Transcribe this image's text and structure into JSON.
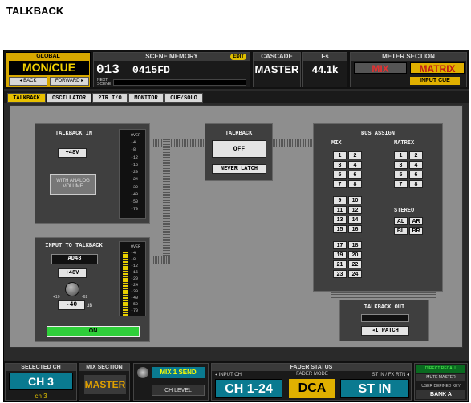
{
  "callout": {
    "label": "TALKBACK"
  },
  "global": {
    "label": "GLOBAL",
    "mode": "MON/CUE",
    "back": "◂ BACK",
    "forward": "FORWARD ▸"
  },
  "scene_memory": {
    "title": "SCENE MEMORY",
    "edit": "EDIT",
    "number": "013",
    "name": "0415FD",
    "next_label": "NEXT SCENE"
  },
  "cascade": {
    "title": "CASCADE",
    "value": "MASTER"
  },
  "fs": {
    "title": "Fs",
    "value": "44.1k"
  },
  "meter_section": {
    "title": "METER SECTION",
    "mix": "MIX",
    "matrix": "MATRIX",
    "input_cue": "INPUT CUE"
  },
  "tabs": [
    "TALKBACK",
    "OSCILLATOR",
    "2TR I/O",
    "MONITOR",
    "CUE/SOLO"
  ],
  "talkback_in": {
    "title": "TALKBACK IN",
    "phantom": "+48V",
    "with_analog_volume": "WITH ANALOG VOLUME"
  },
  "meter_scale": [
    "OVER",
    "-4",
    "-8",
    "-12",
    "-16",
    "-20",
    "-24",
    "-30",
    "-40",
    "-50",
    "-70"
  ],
  "talkback": {
    "title": "TALKBACK",
    "state": "OFF",
    "latch": "NEVER LATCH"
  },
  "input_to_talkback": {
    "title": "INPUT TO TALKBACK",
    "input": "AD48",
    "phantom": "+48V",
    "gain_max": "+10",
    "gain_min": "-62",
    "gain_value": "-40",
    "gain_unit": "dB",
    "on": "ON"
  },
  "bus_assign": {
    "title": "BUS ASSIGN",
    "mix_label": "MIX",
    "matrix_label": "MATRIX",
    "stereo_label": "STEREO",
    "mix_buses": [
      "1",
      "2",
      "3",
      "4",
      "5",
      "6",
      "7",
      "8",
      "9",
      "10",
      "11",
      "12",
      "13",
      "14",
      "15",
      "16",
      "17",
      "18",
      "19",
      "20",
      "21",
      "22",
      "23",
      "24"
    ],
    "matrix_buses": [
      "1",
      "2",
      "3",
      "4",
      "5",
      "6",
      "7",
      "8"
    ],
    "stereo_buses": [
      "AL",
      "AR",
      "BL",
      "BR"
    ]
  },
  "talkback_out": {
    "title": "TALKBACK OUT",
    "patch": "◂I PATCH"
  },
  "bottom": {
    "selected_ch_title": "SELECTED CH",
    "selected_ch": "CH 3",
    "selected_ch_sub": "ch 3",
    "mix_section_title": "MIX SECTION",
    "mix_section": "MASTER",
    "mix1_send": "MIX 1 SEND",
    "ch_level": "CH LEVEL",
    "fader_status_title": "FADER STATUS",
    "input_ch_label": "◂ INPUT CH",
    "input_ch": "CH 1-24",
    "fader_mode_label": "FADER MODE",
    "fader_mode": "DCA",
    "st_in_label": "ST IN / FX RTN ◂",
    "st_in": "ST IN",
    "direct_recall": "DIRECT RECALL",
    "mute_master": "MUTE MASTER",
    "user_defined": "USER DEFINED KEY",
    "bank": "BANK A"
  }
}
